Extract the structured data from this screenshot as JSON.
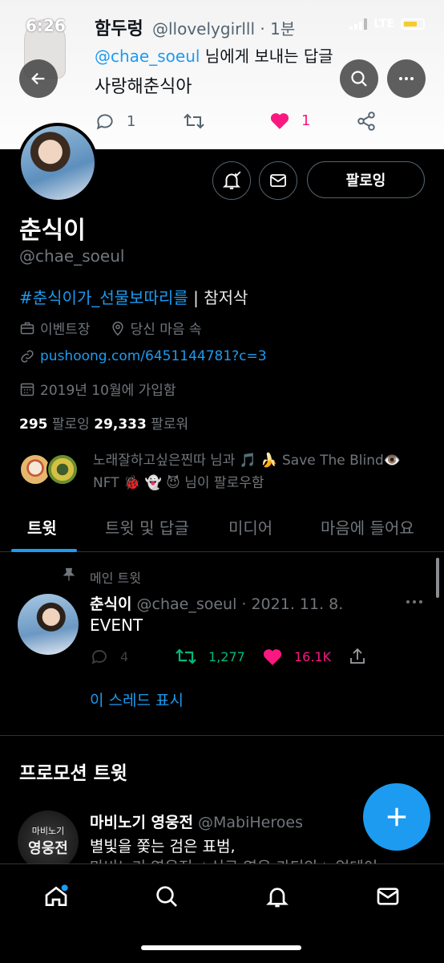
{
  "status_bar": {
    "time": "6:26",
    "network": "LTE"
  },
  "background_tweet": {
    "name": "함두렁",
    "handle_time": "@llovelygirlll · 1분",
    "reply_to_handle": "@chae_soeul",
    "reply_suffix": " 님에게 보내는 답글",
    "text": "사랑해춘식아",
    "reply_count": "1",
    "like_count": "1"
  },
  "profile": {
    "display_name": "춘식이",
    "handle": "@chae_soeul",
    "bio_hashtag": "#춘식이가_선물보따리를",
    "bio_rest": " | 참저삭",
    "category": "이벤트장",
    "location": "당신 마음 속",
    "url": "pushoong.com/6451144781?c=3",
    "joined": "2019년 10월에 가입함",
    "following_count": "295",
    "following_label": " 팔로잉  ",
    "followers_count": "29,333",
    "followers_label": " 팔로워",
    "followed_by_line1": "노래잘하고싶은찐따 님과 🎵 🍌 Save The Blind👁️",
    "followed_by_line2": "NFT 🐞 👻 😈  님이 팔로우함",
    "follow_button_label": "팔로잉"
  },
  "tabs": [
    {
      "label": "트윗"
    },
    {
      "label": "트윗 및 답글"
    },
    {
      "label": "미디어"
    },
    {
      "label": "마음에 들어요"
    }
  ],
  "pinned_tweet": {
    "pinned_label": "메인 트윗",
    "name": "춘식이",
    "handle_date": " @chae_soeul · 2021. 11. 8.",
    "text": "EVENT",
    "reply_count": "4",
    "retweet_count": "1,277",
    "like_count": "16.1K",
    "show_thread": "이 스레드 표시"
  },
  "promo_section": {
    "title": "프로모션 트윗",
    "name": "마비노기 영웅전",
    "handle": " @MabiHeroes",
    "text_line1": "별빛을 쫓는 검은 표범,",
    "text_line2": "마비노기 영웅전 ✦신규 영웅 카디안✦ 업데이",
    "avatar_line1": "마비노기",
    "avatar_line2": "영웅전"
  },
  "colors": {
    "accent": "#1d9bf0",
    "retweet_green": "#00ba7c",
    "like_pink": "#f91880",
    "background": "#000000",
    "secondary_text": "#71767b"
  }
}
